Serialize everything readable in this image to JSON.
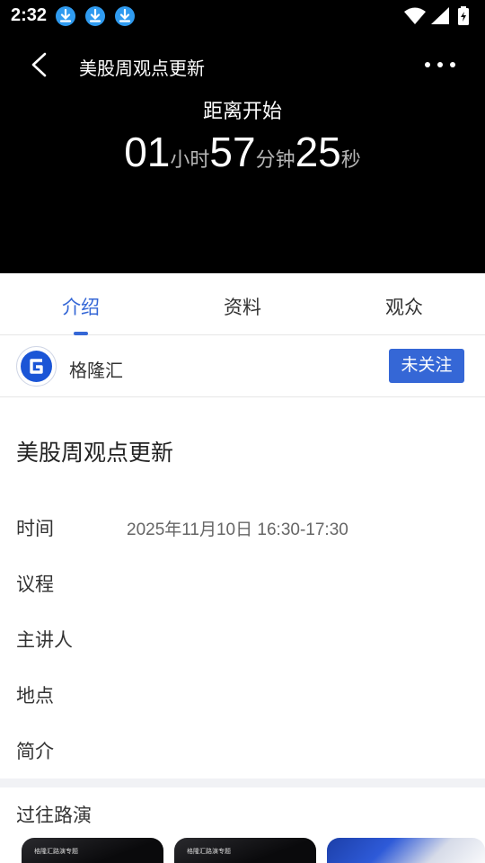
{
  "status_bar": {
    "time": "2:32"
  },
  "nav": {
    "title": "美股周观点更新"
  },
  "countdown": {
    "label": "距离开始",
    "hours": "01",
    "hours_unit": "小时",
    "minutes": "57",
    "minutes_unit": "分钟",
    "seconds": "25",
    "seconds_unit": "秒"
  },
  "tabs": [
    {
      "label": "介绍",
      "active": true
    },
    {
      "label": "资料",
      "active": false
    },
    {
      "label": "观众",
      "active": false
    }
  ],
  "host": {
    "name": "格隆汇",
    "follow_label": "未关注"
  },
  "event": {
    "title": "美股周观点更新",
    "info": [
      {
        "label": "时间",
        "value": "2025年11月10日 16:30-17:30"
      },
      {
        "label": "议程",
        "value": ""
      },
      {
        "label": "主讲人",
        "value": ""
      },
      {
        "label": "地点",
        "value": ""
      },
      {
        "label": "简介",
        "value": ""
      }
    ]
  },
  "past": {
    "title": "过往路演",
    "items": [
      {
        "caption": "格隆汇路演专题"
      },
      {
        "caption": "格隆汇路演专题"
      },
      {
        "caption": ""
      }
    ]
  },
  "colors": {
    "accent": "#3567d6",
    "header_bg": "#000000",
    "download_badge": "#2f9bf0"
  },
  "icons": [
    "download-icon",
    "wifi-icon",
    "signal-icon",
    "battery-icon",
    "back-arrow-icon",
    "more-icon",
    "host-logo-icon"
  ]
}
